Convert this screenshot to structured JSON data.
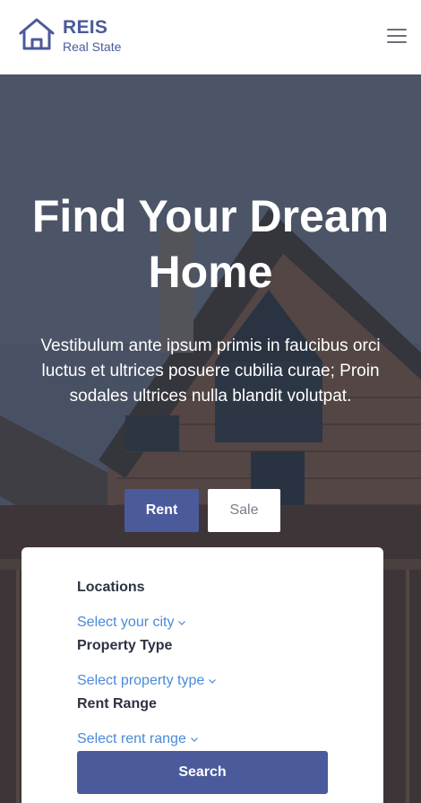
{
  "brand": {
    "name": "REIS",
    "tagline": "Real State"
  },
  "nav": {
    "menu_icon": "hamburger-menu-icon"
  },
  "hero": {
    "title": "Find Your Dream Home",
    "text": "Vestibulum ante ipsum primis in faucibus orci luctus et ultrices posuere cubilia curae; Proin sodales ultrices nulla blandit volutpat."
  },
  "tabs": [
    {
      "label": "Rent",
      "active": true
    },
    {
      "label": "Sale",
      "active": false
    }
  ],
  "search": {
    "fields": [
      {
        "label": "Locations",
        "value": "Select your city"
      },
      {
        "label": "Property Type",
        "value": "Select property type"
      },
      {
        "label": "Rent Range",
        "value": "Select rent range"
      }
    ],
    "button_label": "Search"
  },
  "colors": {
    "accent": "#4b5a9b",
    "link": "#4a8ad8",
    "text_dark": "#2d3242"
  }
}
